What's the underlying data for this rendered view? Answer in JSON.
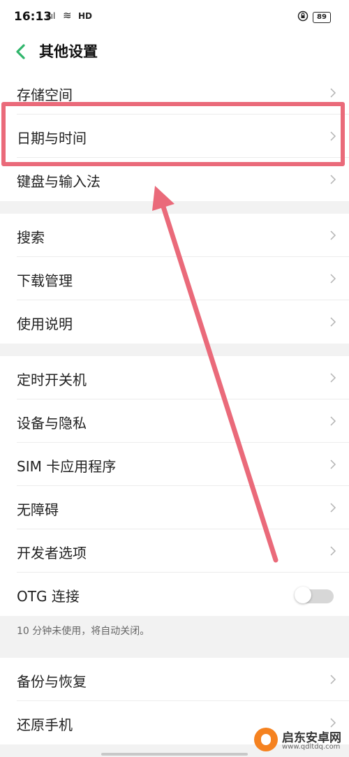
{
  "status_bar": {
    "time": "16:13",
    "signal": "ıııl",
    "wifi": "≋",
    "network": "HD",
    "battery": "89"
  },
  "nav": {
    "title": "其他设置"
  },
  "groups": [
    {
      "items": [
        "存储空间",
        "日期与时间",
        "键盘与输入法"
      ]
    },
    {
      "items": [
        "搜索",
        "下载管理",
        "使用说明"
      ]
    },
    {
      "items": [
        "定时开关机",
        "设备与隐私",
        "SIM 卡应用程序",
        "无障碍",
        "开发者选项",
        "OTG 连接"
      ]
    },
    {
      "items": [
        "备份与恢复",
        "还原手机"
      ]
    }
  ],
  "otg": {
    "enabled": false
  },
  "otg_hint": "10 分钟未使用，将自动关闭。",
  "watermark": {
    "name": "启东安卓网",
    "url": "www.qdltdq.com"
  },
  "colors": {
    "accent": "#2fb56b",
    "highlight": "#ea6a7a",
    "background": "#f2f2f2"
  }
}
